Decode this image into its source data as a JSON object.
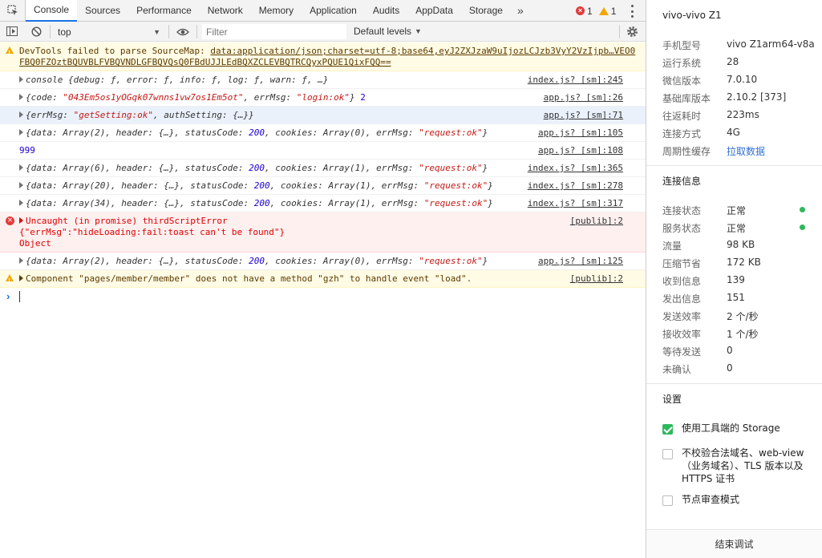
{
  "tabs": [
    "Console",
    "Sources",
    "Performance",
    "Network",
    "Memory",
    "Application",
    "Audits",
    "AppData",
    "Storage"
  ],
  "tabs_more": "»",
  "counters": {
    "errors": "1",
    "warnings": "1"
  },
  "toolbar": {
    "context": "top",
    "filter_placeholder": "Filter",
    "levels": "Default levels"
  },
  "console": {
    "r1": {
      "text": "DevTools failed to parse SourceMap: ",
      "link": "data:application/json;charset=utf-8;base64,eyJ2ZXJzaW9uIjozLCJzb3VyY2VzIjpb…VEO0FBQ0FZOztBQUVBLFVBQVNDLGFBQVQsQ0FBdUJJLEdBQXZCLEVBQTRCQyxPQUE1QixFQQ=="
    },
    "r2": {
      "text": "console {debug: ƒ, error: ƒ, info: ƒ, log: ƒ, warn: ƒ, …}",
      "src": "index.js? [sm]:245"
    },
    "r3": {
      "pre": "{code: ",
      "code": "\"043Em5os1yOGqk07wnns1vw7os1Em5ot\"",
      "mid": ", errMsg: ",
      "msg": "\"login:ok\"",
      "post": "}",
      "num": "2",
      "src": "app.js? [sm]:26"
    },
    "r4": {
      "pre": "{errMsg: ",
      "msg": "\"getSetting:ok\"",
      "post": ", authSetting: {…}}",
      "src": "app.js? [sm]:71"
    },
    "r5": {
      "a": "{data: Array(2), header: {…}, statusCode: ",
      "code": "200",
      "b": ", cookies: Array(0), errMsg: ",
      "msg": "\"request:ok\"",
      "c": "}",
      "src": "app.js? [sm]:105"
    },
    "r6": {
      "text": "999",
      "src": "app.js? [sm]:108"
    },
    "r7": {
      "a": "{data: Array(6), header: {…}, statusCode: ",
      "code": "200",
      "b": ", cookies: Array(1), errMsg: ",
      "msg": "\"request:ok\"",
      "c": "}",
      "src": "index.js? [sm]:365"
    },
    "r8": {
      "a": "{data: Array(20), header: {…}, statusCode: ",
      "code": "200",
      "b": ", cookies: Array(1), errMsg: ",
      "msg": "\"request:ok\"",
      "c": "}",
      "src": "index.js? [sm]:278"
    },
    "r9": {
      "a": "{data: Array(34), header: {…}, statusCode: ",
      "code": "200",
      "b": ", cookies: Array(1), errMsg: ",
      "msg": "\"request:ok\"",
      "c": "}",
      "src": "index.js? [sm]:317"
    },
    "r10": {
      "l1": "Uncaught (in promise) thirdScriptError",
      "l2": "{\"errMsg\":\"hideLoading:fail:toast can't be found\"}",
      "l3": "Object",
      "src": "[publib]:2"
    },
    "r11": {
      "a": "{data: Array(2), header: {…}, statusCode: ",
      "code": "200",
      "b": ", cookies: Array(0), errMsg: ",
      "msg": "\"request:ok\"",
      "c": "}",
      "src": "app.js? [sm]:125"
    },
    "r12": {
      "text": "Component \"pages/member/member\" does not have a method \"gzh\" to handle event \"load\".",
      "src": "[publib]:2"
    }
  },
  "side": {
    "title": "vivo-vivo Z1",
    "device": [
      {
        "k": "手机型号",
        "v": "vivo Z1arm64-v8a"
      },
      {
        "k": "运行系统",
        "v": "28"
      },
      {
        "k": "微信版本",
        "v": "7.0.10"
      },
      {
        "k": "基础库版本",
        "v": "2.10.2 [373]"
      },
      {
        "k": "往返耗时",
        "v": "223ms"
      },
      {
        "k": "连接方式",
        "v": "4G"
      },
      {
        "k": "周期性缓存",
        "v": "拉取数据"
      }
    ],
    "conn_title": "连接信息",
    "conn": [
      {
        "k": "连接状态",
        "v": "正常"
      },
      {
        "k": "服务状态",
        "v": "正常"
      },
      {
        "k": "流量",
        "v": "98 KB"
      },
      {
        "k": "压缩节省",
        "v": "172 KB"
      },
      {
        "k": "收到信息",
        "v": "139"
      },
      {
        "k": "发出信息",
        "v": "151"
      },
      {
        "k": "发送效率",
        "v": "2 个/秒"
      },
      {
        "k": "接收效率",
        "v": "1 个/秒"
      },
      {
        "k": "等待发送",
        "v": "0"
      },
      {
        "k": "未确认",
        "v": "0"
      }
    ],
    "settings_title": "设置",
    "settings": [
      {
        "label": "使用工具端的 Storage",
        "checked": true
      },
      {
        "label": "不校验合法域名、web-view（业务域名）、TLS 版本以及 HTTPS 证书",
        "checked": false
      },
      {
        "label": "节点审查模式",
        "checked": false
      }
    ],
    "stop": "结束调试"
  }
}
